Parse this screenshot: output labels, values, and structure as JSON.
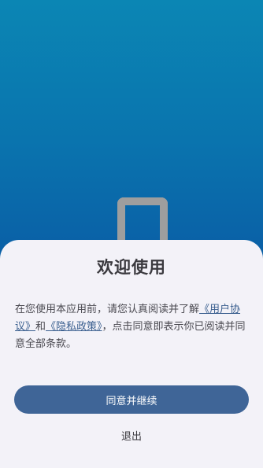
{
  "dialog": {
    "title": "欢迎使用",
    "body_prefix": "在您使用本应用前，请您认真阅读并了解",
    "user_agreement_link": "《用户协议》",
    "conjunction": "和",
    "privacy_policy_link": "《隐私政策》",
    "body_suffix": "，点击同意即表示你已阅读并同意全部条款。",
    "agree_button": "同意并继续",
    "exit_button": "退出"
  },
  "colors": {
    "background_top": "#0b86b4",
    "background_bottom": "#0a4f9c",
    "sheet": "#f3f2f8",
    "primary_button": "#3f6597",
    "link": "#3a5f8f"
  },
  "icons": {
    "splash_logo": "app-logo-icon"
  }
}
